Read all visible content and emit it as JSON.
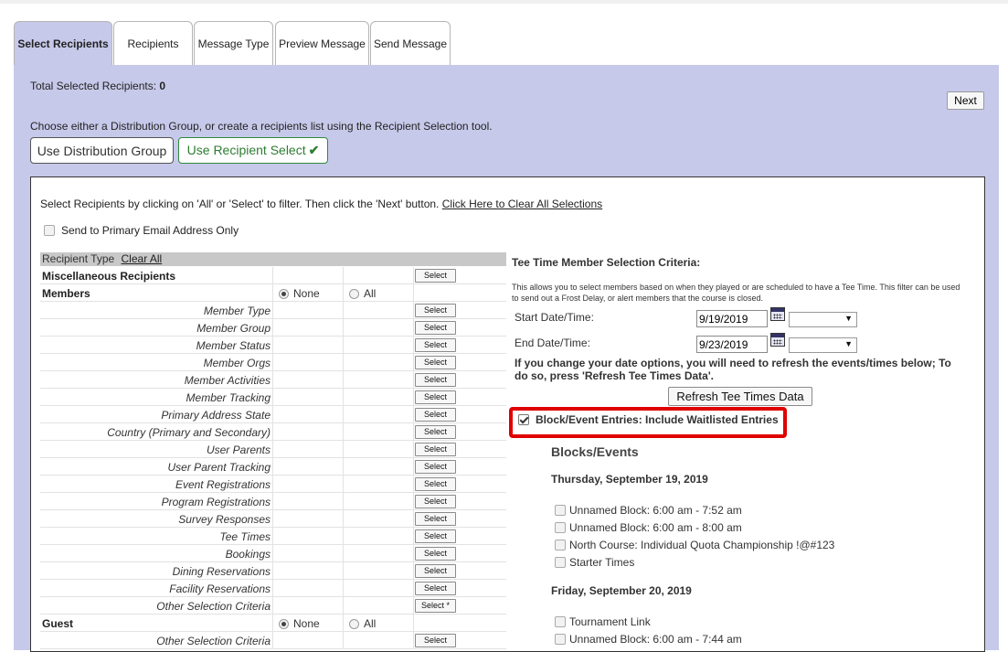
{
  "tabs": [
    {
      "label": "Select Recipients",
      "active": true
    },
    {
      "label": "Recipients",
      "active": false
    },
    {
      "label": "Message Type",
      "active": false
    },
    {
      "label": "Preview Message",
      "active": false
    },
    {
      "label": "Send Message",
      "active": false
    }
  ],
  "summary": {
    "total_label": "Total Selected Recipients:",
    "total_value": "0"
  },
  "next_label": "Next",
  "choose_text": "Choose either a Distribution Group, or create a recipients list using the Recipient Selection tool.",
  "use_dist_label": "Use Distribution Group",
  "use_recipient_label": "Use Recipient Select",
  "instructions": "Select Recipients by clicking on 'All' or 'Select' to filter. Then click the 'Next' button.",
  "clear_all_selections": "Click Here to Clear All Selections",
  "primary_email_label": "Send to Primary Email Address Only",
  "table": {
    "header": "Recipient Type",
    "clear_all": "Clear All",
    "rows": [
      {
        "label": "Miscellaneous Recipients",
        "kind": "group",
        "button": "Select"
      },
      {
        "label": "Members",
        "kind": "radio",
        "opt1": "None",
        "opt2": "All",
        "selected": "none"
      },
      {
        "label": "Member Type",
        "kind": "item",
        "button": "Select"
      },
      {
        "label": "Member Group",
        "kind": "item",
        "button": "Select"
      },
      {
        "label": "Member Status",
        "kind": "item",
        "button": "Select"
      },
      {
        "label": "Member Orgs",
        "kind": "item",
        "button": "Select"
      },
      {
        "label": "Member Activities",
        "kind": "item",
        "button": "Select"
      },
      {
        "label": "Member Tracking",
        "kind": "item",
        "button": "Select"
      },
      {
        "label": "Primary Address State",
        "kind": "item",
        "button": "Select"
      },
      {
        "label": "Country (Primary and Secondary)",
        "kind": "item",
        "button": "Select"
      },
      {
        "label": "User Parents",
        "kind": "item",
        "button": "Select"
      },
      {
        "label": "User Parent Tracking",
        "kind": "item",
        "button": "Select"
      },
      {
        "label": "Event Registrations",
        "kind": "item",
        "button": "Select"
      },
      {
        "label": "Program Registrations",
        "kind": "item",
        "button": "Select"
      },
      {
        "label": "Survey Responses",
        "kind": "item",
        "button": "Select"
      },
      {
        "label": "Tee Times",
        "kind": "item",
        "button": "Select"
      },
      {
        "label": "Bookings",
        "kind": "item",
        "button": "Select"
      },
      {
        "label": "Dining Reservations",
        "kind": "item",
        "button": "Select"
      },
      {
        "label": "Facility Reservations",
        "kind": "item",
        "button": "Select"
      },
      {
        "label": "Other Selection Criteria",
        "kind": "item",
        "button": "Select *"
      },
      {
        "label": "Guest",
        "kind": "radio",
        "opt1": "None",
        "opt2": "All",
        "selected": "none"
      },
      {
        "label": "Other Selection Criteria",
        "kind": "item",
        "button": "Select"
      }
    ]
  },
  "criteria": {
    "title": "Tee Time Member Selection Criteria:",
    "description": "This allows you to select members based on when they played or are scheduled to have a Tee Time. This filter can be used to send out a Frost Delay, or alert members that the course is closed.",
    "start_label": "Start Date/Time:",
    "start_date": "9/19/2019",
    "end_label": "End Date/Time:",
    "end_date": "9/23/2019",
    "change_note": "If you change your date options, you will need to refresh the events/times below; To do so, press 'Refresh Tee Times Data'.",
    "refresh_label": "Refresh Tee Times Data",
    "waitlist_label": "Block/Event Entries: Include Waitlisted Entries",
    "waitlist_checked": true,
    "blocks_title": "Blocks/Events",
    "days": [
      {
        "heading": "Thursday, September 19, 2019",
        "events": [
          "Unnamed Block: 6:00 am - 7:52 am",
          "Unnamed Block: 6:00 am - 8:00 am",
          "North Course: Individual Quota Championship !@#123",
          "Starter Times"
        ]
      },
      {
        "heading": "Friday, September 20, 2019",
        "events": [
          "Tournament Link",
          "Unnamed Block: 6:00 am - 7:44 am"
        ]
      }
    ]
  },
  "colors": {
    "panel": "#c7c9ea",
    "highlight": "#e00000",
    "accent_green": "#2e7d32"
  }
}
